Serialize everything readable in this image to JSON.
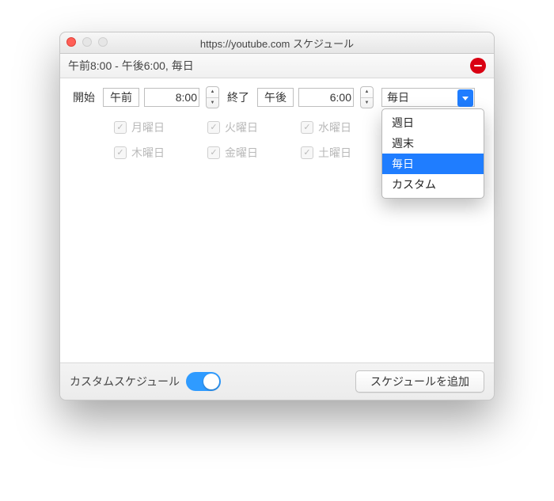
{
  "window": {
    "title": "https://youtube.com スケジュール"
  },
  "schedule": {
    "summary": "午前8:00 - 午後6:00, 毎日",
    "start_label": "開始",
    "start_ampm": "午前",
    "start_time": "8:00",
    "end_label": "終了",
    "end_ampm": "午後",
    "end_time": "6:00",
    "frequency_selected": "毎日",
    "frequency_options": {
      "weekday": "週日",
      "weekend": "週末",
      "everyday": "毎日",
      "custom": "カスタム"
    },
    "days": {
      "mon": "月曜日",
      "tue": "火曜日",
      "wed": "水曜日",
      "thu": "木曜日",
      "fri": "金曜日",
      "sat": "土曜日"
    }
  },
  "footer": {
    "custom_label": "カスタムスケジュール",
    "toggle_on": true,
    "add_button": "スケジュールを追加"
  },
  "colors": {
    "accent": "#1f7dff",
    "danger": "#d90012"
  }
}
